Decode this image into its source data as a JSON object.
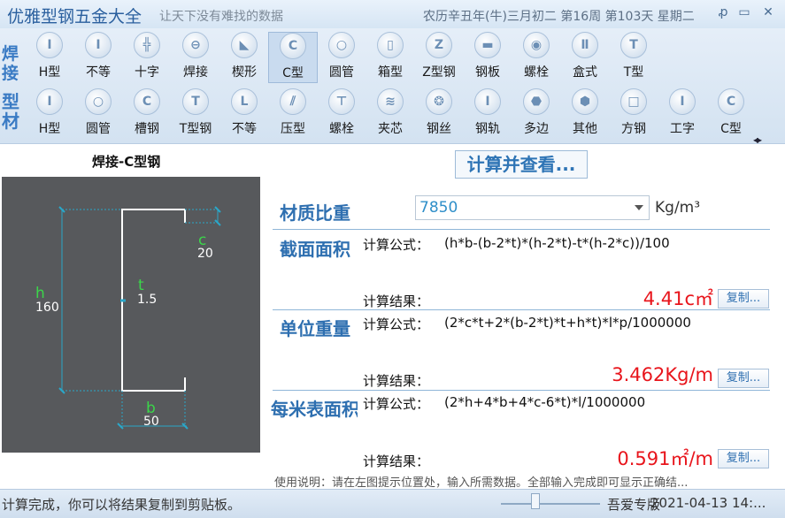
{
  "titlebar": {
    "app_title": "优雅型钢五金大全",
    "slogan": "让天下没有难找的数据",
    "date_info": "农历辛丑年(牛)三月初二 第16周 第103天 星期二",
    "pin": "ꝓ",
    "minimize": "▭",
    "close": "✕"
  },
  "toolbar": {
    "group1_label": "焊接",
    "group2_label": "型材",
    "row1": [
      {
        "label": "H型",
        "icon": "h-beam-icon",
        "glyph": "I"
      },
      {
        "label": "不等",
        "icon": "unequal-icon",
        "glyph": "I"
      },
      {
        "label": "十字",
        "icon": "cross-icon",
        "glyph": "╬"
      },
      {
        "label": "焊接",
        "icon": "weld-icon",
        "glyph": "⊖"
      },
      {
        "label": "楔形",
        "icon": "wedge-icon",
        "glyph": "◣"
      },
      {
        "label": "C型",
        "icon": "c-channel-icon",
        "glyph": "C"
      },
      {
        "label": "圆管",
        "icon": "round-tube-icon",
        "glyph": "○"
      },
      {
        "label": "箱型",
        "icon": "box-icon",
        "glyph": "▯"
      },
      {
        "label": "Z型钢",
        "icon": "z-steel-icon",
        "glyph": "Z"
      },
      {
        "label": "钢板",
        "icon": "steel-plate-icon",
        "glyph": "▬"
      },
      {
        "label": "螺栓",
        "icon": "bolt-icon",
        "glyph": "◉"
      },
      {
        "label": "盒式",
        "icon": "box-type-icon",
        "glyph": "Ⅱ"
      },
      {
        "label": "T型",
        "icon": "t-shape-icon",
        "glyph": "T"
      }
    ],
    "row2": [
      {
        "label": "H型",
        "icon": "h-beam-icon",
        "glyph": "I"
      },
      {
        "label": "圆管",
        "icon": "round-tube-icon",
        "glyph": "○"
      },
      {
        "label": "槽钢",
        "icon": "channel-icon",
        "glyph": "C"
      },
      {
        "label": "T型钢",
        "icon": "t-steel-icon",
        "glyph": "T"
      },
      {
        "label": "不等",
        "icon": "unequal-angle-icon",
        "glyph": "L"
      },
      {
        "label": "压型",
        "icon": "profiled-icon",
        "glyph": "⫽"
      },
      {
        "label": "螺栓",
        "icon": "bolt-icon",
        "glyph": "⊤"
      },
      {
        "label": "夹芯",
        "icon": "sandwich-icon",
        "glyph": "≋"
      },
      {
        "label": "钢丝",
        "icon": "wire-icon",
        "glyph": "❂"
      },
      {
        "label": "钢轨",
        "icon": "rail-icon",
        "glyph": "I"
      },
      {
        "label": "多边",
        "icon": "polygon-icon",
        "glyph": "⬣"
      },
      {
        "label": "其他",
        "icon": "other-icon",
        "glyph": "⬢"
      },
      {
        "label": "方钢",
        "icon": "square-steel-icon",
        "glyph": "□"
      },
      {
        "label": "工字",
        "icon": "i-beam-icon",
        "glyph": "I"
      },
      {
        "label": "C型",
        "icon": "c-shape-icon",
        "glyph": "C"
      }
    ],
    "more": "◂▸"
  },
  "diagram": {
    "title": "焊接-C型钢",
    "labels": {
      "h_name": "h",
      "h_value": "160",
      "t_name": "t",
      "t_value": "1.5",
      "c_name": "c",
      "c_value": "20",
      "b_name": "b",
      "b_value": "50"
    }
  },
  "main": {
    "calc_button": "计算并查看...",
    "density_label": "材质比重",
    "density_value": "7850",
    "density_unit": "Kg/m³",
    "formula_label": "计算公式：",
    "result_label": "计算结果：",
    "copy_label": "复制...",
    "sections": [
      {
        "title": "截面面积",
        "formula": "(h*b-(b-2*t)*(h-2*t)-t*(h-2*c))/100",
        "result": "4.41c㎡"
      },
      {
        "title": "单位重量",
        "formula": "(2*c*t+2*(b-2*t)*t+h*t)*l*p/1000000",
        "result": "3.462Kg/m"
      },
      {
        "title": "每米表面积",
        "formula": "(2*h+4*b+4*c-6*t)*l/1000000",
        "result": "0.591㎡/m"
      }
    ],
    "usage": "使用说明：请在左图提示位置处，输入所需数据。全部输入完成即可显示正确结..."
  },
  "statusbar": {
    "message": "计算完成，你可以将结果复制到剪贴板。",
    "edition": "吾爱专版",
    "datetime": "2021-04-13 14:..."
  }
}
